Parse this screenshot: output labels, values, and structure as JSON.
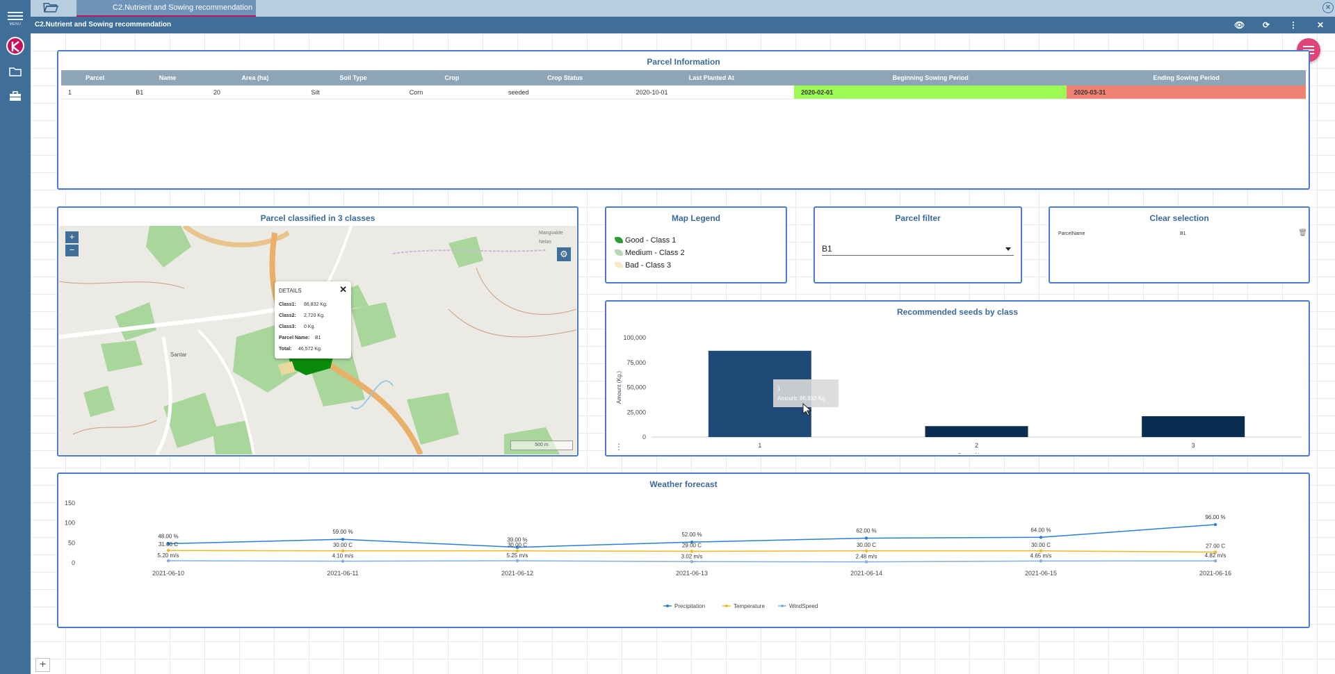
{
  "app": {
    "menu_label": "MENU",
    "tab_title": "C2.Nutrient and Sowing recommendation",
    "window_title": "C2.Nutrient and Sowing recommendation",
    "add_label": "+"
  },
  "parcel_info": {
    "title": "Parcel Information",
    "columns": [
      "Parcel",
      "Name",
      "Area (ha)",
      "Soil Type",
      "Crop",
      "Crop Status",
      "Last Planted At",
      "Beginning Sowing Period",
      "Ending Sowing Period"
    ],
    "rows": [
      [
        "1",
        "B1",
        "20",
        "Silt",
        "Corn",
        "seeded",
        "2020-10-01",
        "2020-02-01",
        "2020-03-31"
      ]
    ],
    "highlight_colors": {
      "beginning": "#9dfa55",
      "ending": "#f08273"
    }
  },
  "map_panel": {
    "title": "Parcel classified in 3 classes",
    "zoom_in": "+",
    "zoom_out": "−",
    "scale_label": "500 m",
    "place_labels": [
      "Santar",
      "Mangualde",
      "Nelas"
    ],
    "popup": {
      "header": "DETAILS",
      "close": "✕",
      "rows": [
        {
          "k": "Class1:",
          "v": "86,832 Kg."
        },
        {
          "k": "Class2:",
          "v": "2,720 Kg."
        },
        {
          "k": "Class3:",
          "v": "0 Kg."
        },
        {
          "k": "Parcel Name:",
          "v": "B1"
        },
        {
          "k": "Total:",
          "v": "46,572 Kg."
        }
      ]
    }
  },
  "map_legend": {
    "title": "Map Legend",
    "items": [
      {
        "label": "Good - Class 1",
        "color": "#2f9a2f"
      },
      {
        "label": "Medium - Class 2",
        "color": "#b9d9b3"
      },
      {
        "label": "Bad - Class 3",
        "color": "#f5ecc6"
      }
    ]
  },
  "parcel_filter": {
    "title": "Parcel filter",
    "selected": "B1"
  },
  "clear_selection": {
    "title": "Clear selection",
    "field": "ParcelName",
    "value": "B1"
  },
  "seeds_chart": {
    "title": "Recommended seeds by class",
    "tooltip_line1": "1",
    "tooltip_line2": "Amount: 86,832 Kg.",
    "chart_data": {
      "type": "bar",
      "categories": [
        "1",
        "2",
        "3"
      ],
      "values": [
        86832,
        11000,
        21000
      ],
      "ylabel": "Amount (Kg.)",
      "xlabel": "Zone Classes",
      "ylim": [
        0,
        100000
      ],
      "yticks": [
        "100,000",
        "75,000",
        "50,000",
        "25,000",
        "0"
      ],
      "colors": [
        "#1f4a78",
        "#0c2d52",
        "#0c2d52"
      ]
    }
  },
  "weather": {
    "title": "Weather forecast",
    "chart_data": {
      "type": "line",
      "x": [
        "2021-06-10",
        "2021-06-11",
        "2021-06-12",
        "2021-06-13",
        "2021-06-14",
        "2021-06-15",
        "2021-06-16"
      ],
      "ylim": [
        0,
        150
      ],
      "yticks": [
        "150",
        "100",
        "50",
        "0"
      ],
      "series": [
        {
          "name": "Precipitation",
          "color": "#2a7fd4",
          "values": [
            48,
            59,
            39,
            52,
            62,
            64,
            96
          ],
          "labels": [
            "48.00 %",
            "59.00 %",
            "39.00 %",
            "52.00 %",
            "62.00 %",
            "64.00 %",
            "96.00 %"
          ]
        },
        {
          "name": "Temperature",
          "color": "#f2b824",
          "values": [
            31,
            30,
            30,
            29,
            30,
            30,
            27
          ],
          "labels": [
            "31.00 C",
            "30.00 C",
            "30.00 C",
            "29.00 C",
            "30.00 C",
            "30.00 C",
            "27.00 C"
          ]
        },
        {
          "name": "WindSpeed",
          "color": "#7fb0e0",
          "values": [
            5.2,
            4.1,
            5.25,
            3.02,
            2.48,
            4.65,
            4.82
          ],
          "labels": [
            "5.20 m/s",
            "4.10 m/s",
            "5.25 m/s",
            "3.02 m/s",
            "2.48 m/s",
            "4.65 m/s",
            "4.82 m/s"
          ]
        }
      ]
    }
  }
}
